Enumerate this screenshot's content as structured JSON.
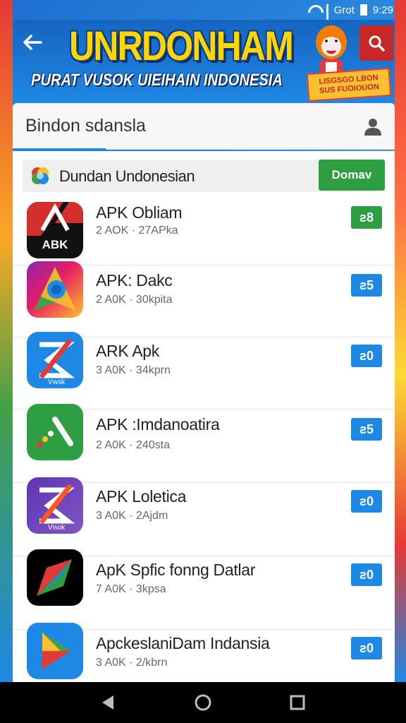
{
  "status_bar": {
    "carrier": "Grot",
    "time": "9:29"
  },
  "header": {
    "title": "UNRDONHAM",
    "subtitle": "PURAT VUSOK UIEIHAIN INDONESIA",
    "promo_badge_line1": "LISGSGO LBON",
    "promo_badge_line2": "SUS FUOIOUON",
    "accent_color": "#ffd600",
    "search_button_color": "#c62828"
  },
  "search": {
    "value": "Bindon sdansla"
  },
  "promo": {
    "label": "Dundan Undonesian",
    "button_label": "Domav",
    "button_color": "#2e9e43"
  },
  "apps": [
    {
      "name": "APK Obliam",
      "meta": "2 AOK · 27APka",
      "button_label": "ƨ8",
      "button_color": "#2e9e43",
      "icon": "apk-red-icon",
      "icon_text": "ABK"
    },
    {
      "name": "APK: Dakc",
      "meta": "2 A0K · 30kpita",
      "button_label": "ƨ5",
      "button_color": "#1e88e5",
      "icon": "chrome-like-icon",
      "icon_text": ""
    },
    {
      "name": "ARK Apk",
      "meta": "3 A0K · 34kprn",
      "button_label": "ƨ0",
      "button_color": "#1e88e5",
      "icon": "blue-arrow-icon",
      "icon_text": "Vwsk"
    },
    {
      "name": "APK :Imdanoatira",
      "meta": "2 A0K · 240sta",
      "button_label": "ƨ5",
      "button_color": "#1e88e5",
      "icon": "green-knife-icon",
      "icon_text": ""
    },
    {
      "name": "APK Loletica",
      "meta": "3 A0K · 2Ajdm",
      "button_label": "ƨ0",
      "button_color": "#1e88e5",
      "icon": "purple-arrow-icon",
      "icon_text": "Visok"
    },
    {
      "name": "ApK Spfic fonng Datlar",
      "meta": "7 A0K · 3kpsa",
      "button_label": "ƨ0",
      "button_color": "#1e88e5",
      "icon": "black-arrow-icon",
      "icon_text": ""
    },
    {
      "name": "ApckeslaniDam Indansia",
      "meta": "3 A0K · 2/kbrn",
      "button_label": "ƨ0",
      "button_color": "#1e88e5",
      "icon": "play-store-icon",
      "icon_text": ""
    }
  ]
}
